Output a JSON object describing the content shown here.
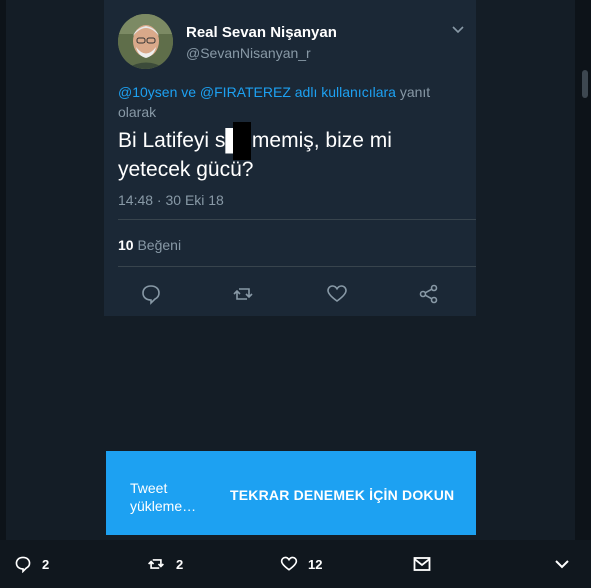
{
  "tweet": {
    "author_name": "Real Sevan Nişanyan",
    "author_handle": "@SevanNisanyan_r",
    "reply_mentions": "@10ysen ve @FIRATEREZ adlı kullanıcılara",
    "reply_suffix": "yanıt olarak",
    "text": "Bi Latifeyi s█ememiş, bize mi yetecek gücü?",
    "timestamp": "14:48 · 30 Eki 18",
    "likes_count": "10",
    "likes_label": "Beğeni"
  },
  "toast": {
    "message": "Tweet yükleme…",
    "action_label": "TEKRAR DENEMEK İÇİN DOKUN"
  },
  "bottom_bar": {
    "replies": "2",
    "retweets": "2",
    "likes": "12"
  },
  "colors": {
    "background": "#141d26",
    "card": "#1b2836",
    "accent": "#1da1f2",
    "muted": "#8899a6"
  }
}
